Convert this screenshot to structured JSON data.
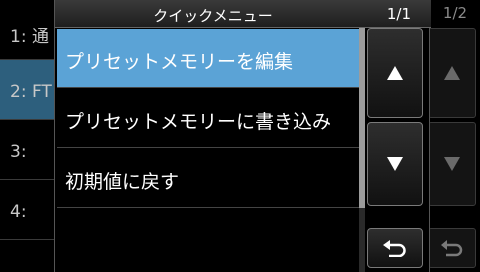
{
  "background": {
    "list": [
      {
        "label": "1: 通"
      },
      {
        "label": "2: FT"
      },
      {
        "label": "3:"
      },
      {
        "label": "4:"
      }
    ],
    "selected_color": "#2d5f7d",
    "page_indicator": "1/2"
  },
  "quick_menu": {
    "title": "クイックメニュー",
    "page_indicator": "1/1",
    "items": [
      {
        "label": "プリセットメモリーを編集",
        "selected": true
      },
      {
        "label": "プリセットメモリーに書き込み",
        "selected": false
      },
      {
        "label": "初期値に戻す",
        "selected": false
      },
      {
        "label": "",
        "selected": false
      }
    ],
    "selected_color": "#5ba3d6",
    "buttons": {
      "up_icon": "triangle-up-icon",
      "down_icon": "triangle-down-icon",
      "return_icon": "return-arrow-icon"
    }
  }
}
